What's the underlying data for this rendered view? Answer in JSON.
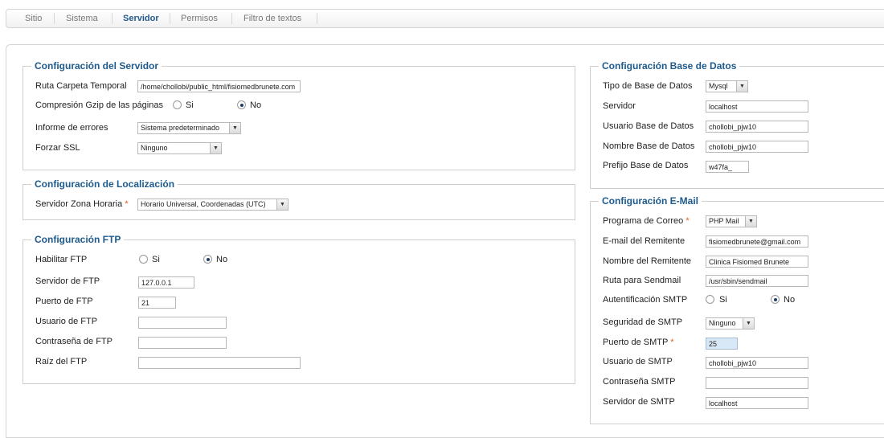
{
  "tabs": [
    {
      "label": "Sitio"
    },
    {
      "label": "Sistema"
    },
    {
      "label": "Servidor"
    },
    {
      "label": "Permisos"
    },
    {
      "label": "Filtro de textos"
    }
  ],
  "active_tab": "Servidor",
  "server": {
    "legend": "Configuración del Servidor",
    "tmp_label": "Ruta Carpeta Temporal",
    "tmp_value": "/home/chollobi/public_html/fisiomedbrunete.com",
    "gzip_label": "Compresión Gzip de las páginas",
    "yes": "Si",
    "no": "No",
    "errors_label": "Informe de errores",
    "errors_value": "Sistema predeterminado",
    "ssl_label": "Forzar SSL",
    "ssl_value": "Ninguno"
  },
  "locale": {
    "legend": "Configuración de Localización",
    "tz_label": "Servidor Zona Horaria",
    "required_mark": "*",
    "tz_value": "Horario Universal, Coordenadas (UTC)"
  },
  "ftp": {
    "legend": "Configuración FTP",
    "enable_label": "Habilitar FTP",
    "yes": "Si",
    "no": "No",
    "host_label": "Servidor de FTP",
    "host_value": "127.0.0.1",
    "port_label": "Puerto de FTP",
    "port_value": "21",
    "user_label": "Usuario de FTP",
    "user_value": "",
    "pass_label": "Contraseña de FTP",
    "pass_value": "",
    "root_label": "Raíz del FTP",
    "root_value": ""
  },
  "db": {
    "legend": "Configuración Base de Datos",
    "type_label": "Tipo de Base de Datos",
    "type_value": "Mysql",
    "host_label": "Servidor",
    "host_value": "localhost",
    "user_label": "Usuario Base de Datos",
    "user_value": "chollobi_pjw10",
    "name_label": "Nombre Base de Datos",
    "name_value": "chollobi_pjw10",
    "prefix_label": "Prefijo Base de Datos",
    "prefix_value": "w47fa_"
  },
  "mail": {
    "legend": "Configuración E-Mail",
    "mailer_label": "Programa de Correo",
    "required_mark": "*",
    "mailer_value": "PHP Mail",
    "from_label": "E-mail del Remitente",
    "from_value": "fisiomedbrunete@gmail.com",
    "fromname_label": "Nombre del Remitente",
    "fromname_value": "Clinica Fisiomed Brunete",
    "sendmail_label": "Ruta para Sendmail",
    "sendmail_value": "/usr/sbin/sendmail",
    "smtpauth_label": "Autentificación SMTP",
    "yes": "Si",
    "no": "No",
    "smtpsecure_label": "Seguridad de SMTP",
    "smtpsecure_value": "Ninguno",
    "smtpport_label": "Puerto de SMTP",
    "smtpport_value": "25",
    "smtpuser_label": "Usuario de SMTP",
    "smtpuser_value": "chollobi_pjw10",
    "smtppass_label": "Contraseña SMTP",
    "smtppass_value": "",
    "smtphost_label": "Servidor de SMTP",
    "smtphost_value": "localhost"
  }
}
